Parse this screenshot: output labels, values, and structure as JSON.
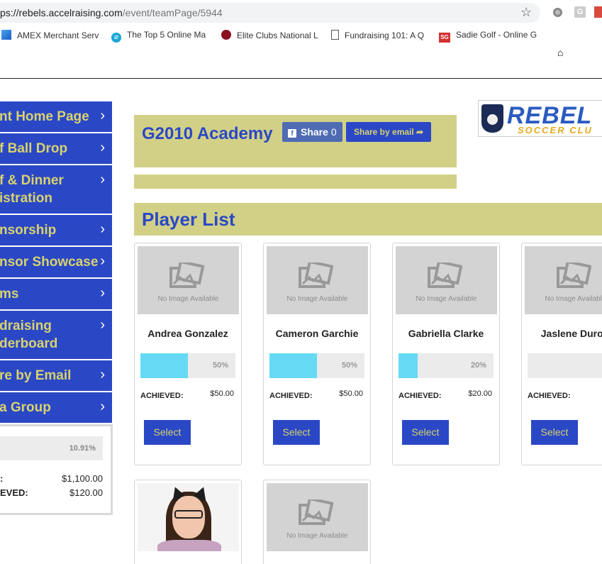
{
  "browser": {
    "url_prefix": "ps://",
    "url_host": "rebels.accelraising.com",
    "url_path": "/event/teamPage/5944",
    "bookmarks": [
      {
        "label": "AMEX Merchant Serv",
        "icon": "amex-icon"
      },
      {
        "label": "The Top 5 Online Ma",
        "icon": "top5-icon"
      },
      {
        "label": "Elite Clubs National L",
        "icon": "elite-icon"
      },
      {
        "label": "Fundraising 101: A Q",
        "icon": "doc-icon"
      },
      {
        "label": "Sadie Golf - Online G",
        "icon": "sg-icon"
      }
    ],
    "ext2_letter": "G",
    "ext4_letter": "",
    "bm_top5_glyph": "⌀",
    "bm_sg_glyph": "SG"
  },
  "sidebar": {
    "items": [
      {
        "label": "nt Home Page"
      },
      {
        "label": "f Ball Drop"
      },
      {
        "label": "f & Dinner\nistration"
      },
      {
        "label": "nsorship"
      },
      {
        "label": "nsor Showcase"
      },
      {
        "label": "ms"
      },
      {
        "label": "draising\nderboard"
      },
      {
        "label": "re by Email"
      },
      {
        "label": "a Group"
      }
    ],
    "chevron": "›"
  },
  "summary": {
    "progress_pct": "10.91%",
    "goal_label": ":",
    "goal_value": "$1,100.00",
    "achieved_label": "EVED:",
    "achieved_value": "$120.00"
  },
  "team": {
    "title": "G2010 Academy",
    "share_label": "Share",
    "share_count": "0",
    "fb_glyph": "f",
    "email_label": "Share by email",
    "email_glyph": "➦"
  },
  "logo": {
    "word": "REBEL",
    "sub": "SOCCER CLU"
  },
  "player_list": {
    "title": "Player List",
    "no_image_text": "No Image Available",
    "achieved_label": "ACHIEVED:",
    "select_label": "Select",
    "players": [
      {
        "name": "Andrea Gonzalez",
        "pct": "50%",
        "achieved": "$50.00",
        "progress": 0.5
      },
      {
        "name": "Cameron Garchie",
        "pct": "50%",
        "achieved": "$50.00",
        "progress": 0.5
      },
      {
        "name": "Gabriella Clarke",
        "pct": "20%",
        "achieved": "$20.00",
        "progress": 0.2
      },
      {
        "name": "Jaslene Duron",
        "pct": "",
        "achieved": "",
        "progress": 0
      }
    ]
  },
  "colors": {
    "accent_blue": "#2a48c6",
    "olive": "#d2d086",
    "gold_text": "#d8d26e",
    "progress_fill": "#66daf5"
  }
}
